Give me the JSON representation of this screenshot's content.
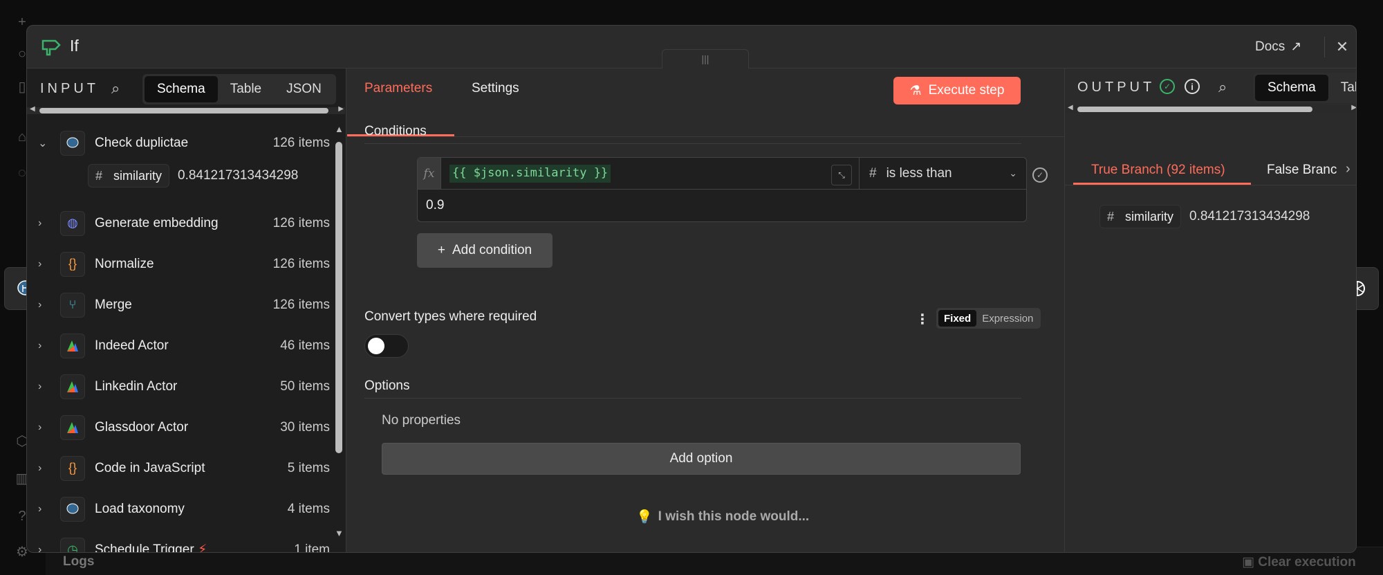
{
  "modal": {
    "title": "If",
    "docs_label": "Docs",
    "drag_handle_label": "|||"
  },
  "input": {
    "label": "INPUT",
    "view_tabs": [
      "Schema",
      "Table",
      "JSON"
    ],
    "active_view": "Schema",
    "nodes": [
      {
        "name": "Check duplictae",
        "count": "126 items",
        "icon": "postgres-icon",
        "expanded": true
      },
      {
        "name": "Generate embedding",
        "count": "126 items",
        "icon": "globe-icon",
        "expanded": false
      },
      {
        "name": "Normalize",
        "count": "126 items",
        "icon": "braces-icon",
        "expanded": false
      },
      {
        "name": "Merge",
        "count": "126 items",
        "icon": "merge-icon",
        "expanded": false
      },
      {
        "name": "Indeed Actor",
        "count": "46 items",
        "icon": "apify-icon",
        "expanded": false
      },
      {
        "name": "Linkedin Actor",
        "count": "50 items",
        "icon": "apify-icon",
        "expanded": false
      },
      {
        "name": "Glassdoor Actor",
        "count": "30 items",
        "icon": "apify-icon",
        "expanded": false
      },
      {
        "name": "Code in JavaScript",
        "count": "5 items",
        "icon": "braces-icon",
        "expanded": false
      },
      {
        "name": "Load taxonomy",
        "count": "4 items",
        "icon": "postgres-icon",
        "expanded": false
      },
      {
        "name": "Schedule Trigger",
        "count": "1 item",
        "icon": "clock-icon",
        "expanded": false
      }
    ],
    "field": {
      "type_symbol": "#",
      "name": "similarity",
      "value": "0.841217313434298"
    }
  },
  "center": {
    "tabs": [
      "Parameters",
      "Settings"
    ],
    "active_tab": "Parameters",
    "execute_label": "Execute step",
    "conditions_label": "Conditions",
    "condition": {
      "fx_label": "fx",
      "expression": "{{ $json.similarity }}",
      "type_symbol": "#",
      "operator": "is less than",
      "value": "0.9"
    },
    "add_condition_label": "Add condition",
    "convert_types_label": "Convert types where required",
    "mode_options": [
      "Fixed",
      "Expression"
    ],
    "active_mode": "Fixed",
    "convert_types_enabled": false,
    "options_label": "Options",
    "no_properties": "No properties",
    "add_option_label": "Add option",
    "wish_label": "I wish this node would..."
  },
  "output": {
    "label": "OUTPUT",
    "view_tabs": [
      "Schema",
      "Table"
    ],
    "active_view": "Schema",
    "branch_tabs": [
      "True Branch (92 items)",
      "False Branc"
    ],
    "active_branch": "True Branch (92 items)",
    "field": {
      "type_symbol": "#",
      "name": "similarity",
      "value": "0.841217313434298"
    }
  },
  "background": {
    "logs_label": "Logs",
    "clear_execution_label": "Clear execution"
  },
  "colors": {
    "accent": "#ff6d5a",
    "success": "#3bb36a",
    "panel_dark": "#1e1e1e",
    "panel": "#2b2b2b"
  }
}
